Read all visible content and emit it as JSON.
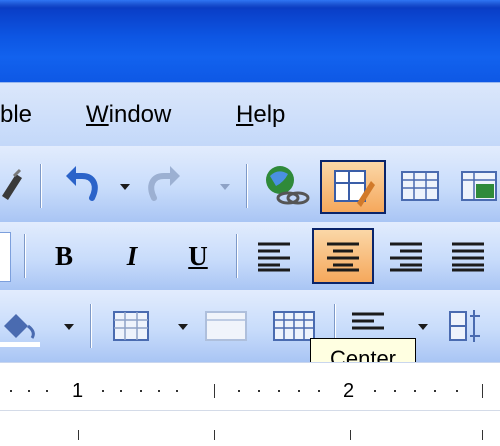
{
  "menu": {
    "table_fragment": "ble",
    "window": {
      "mnemonic": "W",
      "rest": "indow"
    },
    "help": {
      "mnemonic": "H",
      "rest": "elp"
    }
  },
  "formatting": {
    "bold": "B",
    "italic": "I",
    "underline": "U"
  },
  "tooltip": "Center",
  "ruler": {
    "labels": [
      "1",
      "2"
    ]
  },
  "colors": {
    "titlebar": "#0d56e3",
    "toolbar": "#c8dcfb",
    "active_button": "#f5a85c",
    "tooltip_bg": "#ffffe1"
  }
}
